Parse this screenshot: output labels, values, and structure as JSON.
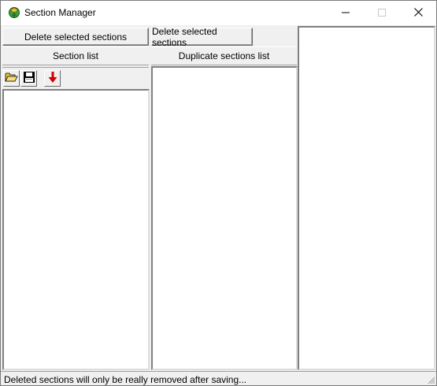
{
  "window": {
    "title": "Section Manager",
    "icon": "section-manager-app-icon",
    "controls": {
      "minimize_icon": "minimize-icon",
      "maximize_icon": "maximize-icon",
      "close_icon": "close-icon"
    }
  },
  "left_panel": {
    "delete_label": "Delete selected sections",
    "header": "Section list",
    "toolbar": [
      {
        "name": "open-folder-icon"
      },
      {
        "name": "save-icon"
      },
      {
        "name": "arrow-down-icon"
      }
    ],
    "items": []
  },
  "middle_panel": {
    "delete_label": "Delete selected sections",
    "header": "Duplicate sections list",
    "items": []
  },
  "right_panel": {
    "items": []
  },
  "status_bar": {
    "text": "Deleted sections will only be really removed after saving..."
  },
  "colors": {
    "window_bg": "#f0f0f0",
    "list_bg": "#ffffff",
    "arrow_red": "#d40000",
    "folder_yellow": "#e8c33a"
  }
}
